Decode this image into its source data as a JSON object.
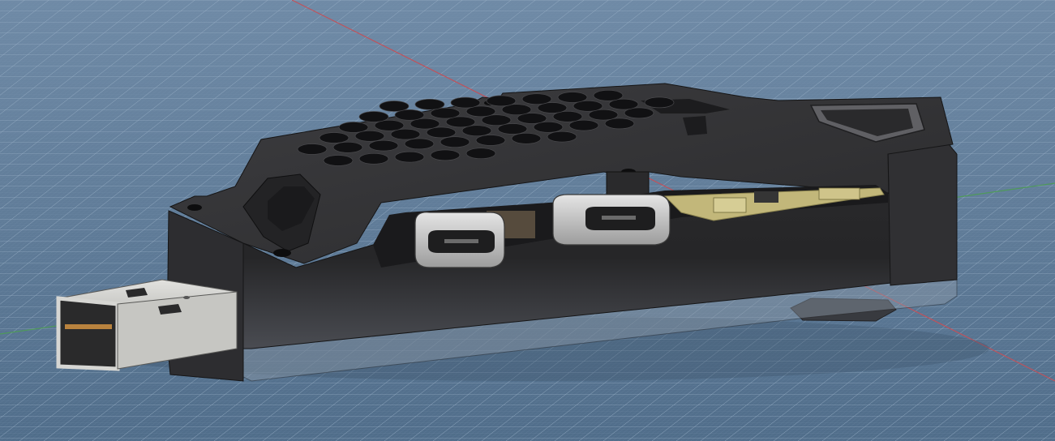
{
  "viewport": {
    "background_top": "#6f8aa6",
    "background_bottom": "#506d8a",
    "grid_color": "#a9bfd4",
    "axis_red": "#c0525b",
    "axis_green": "#4f9a5a"
  },
  "model": {
    "name": "",
    "body_color": "#2f2f31",
    "body_shade": "#1f1f21",
    "pcb_color": "#c2b77a",
    "usb_plug_color": "#d8d8d6",
    "usb_c_color": "#c9c9c9",
    "vent_holes": 47
  }
}
